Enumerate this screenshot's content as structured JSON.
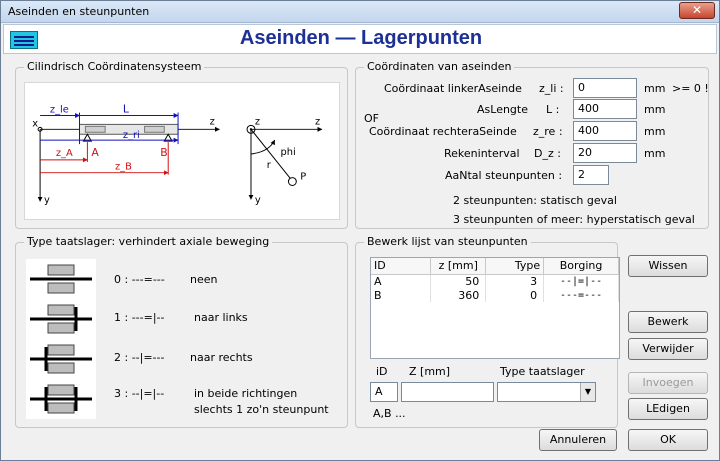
{
  "window": {
    "title": "Aseinden en steunpunten",
    "close": "✕"
  },
  "header": {
    "title": "Aseinden — Lagerpunten"
  },
  "coord_group": {
    "title": "Cilindrisch Coördinatensysteem",
    "diagram": {
      "x": "x",
      "z": "z",
      "y": "y",
      "zle": "z_le",
      "L": "L",
      "zri": "z_ri",
      "zA": "z_A",
      "zB": "z_B",
      "A": "A",
      "B": "B",
      "phi": "phi",
      "r": "r",
      "P": "P"
    }
  },
  "coords_panel": {
    "title": "Coördinaten van aseinden",
    "rows": [
      {
        "label": "Coördinaat linkerAseinde",
        "sym": "z_li :",
        "value": "0",
        "unit": "mm",
        "note": ">= 0 !"
      },
      {
        "label": "AsLengte",
        "sym": "L :",
        "value": "400",
        "unit": "mm"
      },
      {
        "label": "Coördinaat rechteraSeinde",
        "sym": "z_re :",
        "value": "400",
        "unit": "mm"
      },
      {
        "label": "Rekeninterval",
        "sym": "D_z :",
        "value": "20",
        "unit": "mm"
      },
      {
        "label": "AaNtal steunpunten :",
        "value": "2"
      }
    ],
    "of": "OF",
    "info1": "2  steunpunten: statisch geval",
    "info2": "3 steunpunten of meer: hyperstatisch geval"
  },
  "bearing_types": {
    "title": "Type taatslager: verhindert axiale beweging",
    "items": [
      {
        "code": "0 : ---=---",
        "desc": "neen"
      },
      {
        "code": "1 : ---=|--",
        "desc": "naar links"
      },
      {
        "code": "2 : --|=---",
        "desc": "naar rechts"
      },
      {
        "code": "3 : --|=|--",
        "desc": "in beide richtingen",
        "desc2": "slechts 1 zo'n steunpunt"
      }
    ]
  },
  "supports": {
    "title": "Bewerk lijst van steunpunten",
    "columns": [
      "ID",
      "z  [mm]",
      "Type",
      "Borging"
    ],
    "rows": [
      {
        "id": "A",
        "z": "50",
        "type": "3",
        "borging": "--|=|--"
      },
      {
        "id": "B",
        "z": "360",
        "type": "0",
        "borging": "---=---"
      }
    ],
    "edit_labels": {
      "id": "iD",
      "z": "Z    [mm]",
      "type": "Type taatslager"
    },
    "edit_id_value": "A",
    "hint": "A,B ...",
    "buttons": {
      "clear": "Wissen",
      "edit": "Bewerk",
      "delete": "Verwijder",
      "insert": "Invoegen",
      "empty": "LEdigen"
    }
  },
  "footer": {
    "cancel": "Annuleren",
    "ok": "OK"
  },
  "colors": {
    "accent": "#1c3096",
    "diagram_blue": "#1010c0",
    "diagram_red": "#d01010"
  }
}
